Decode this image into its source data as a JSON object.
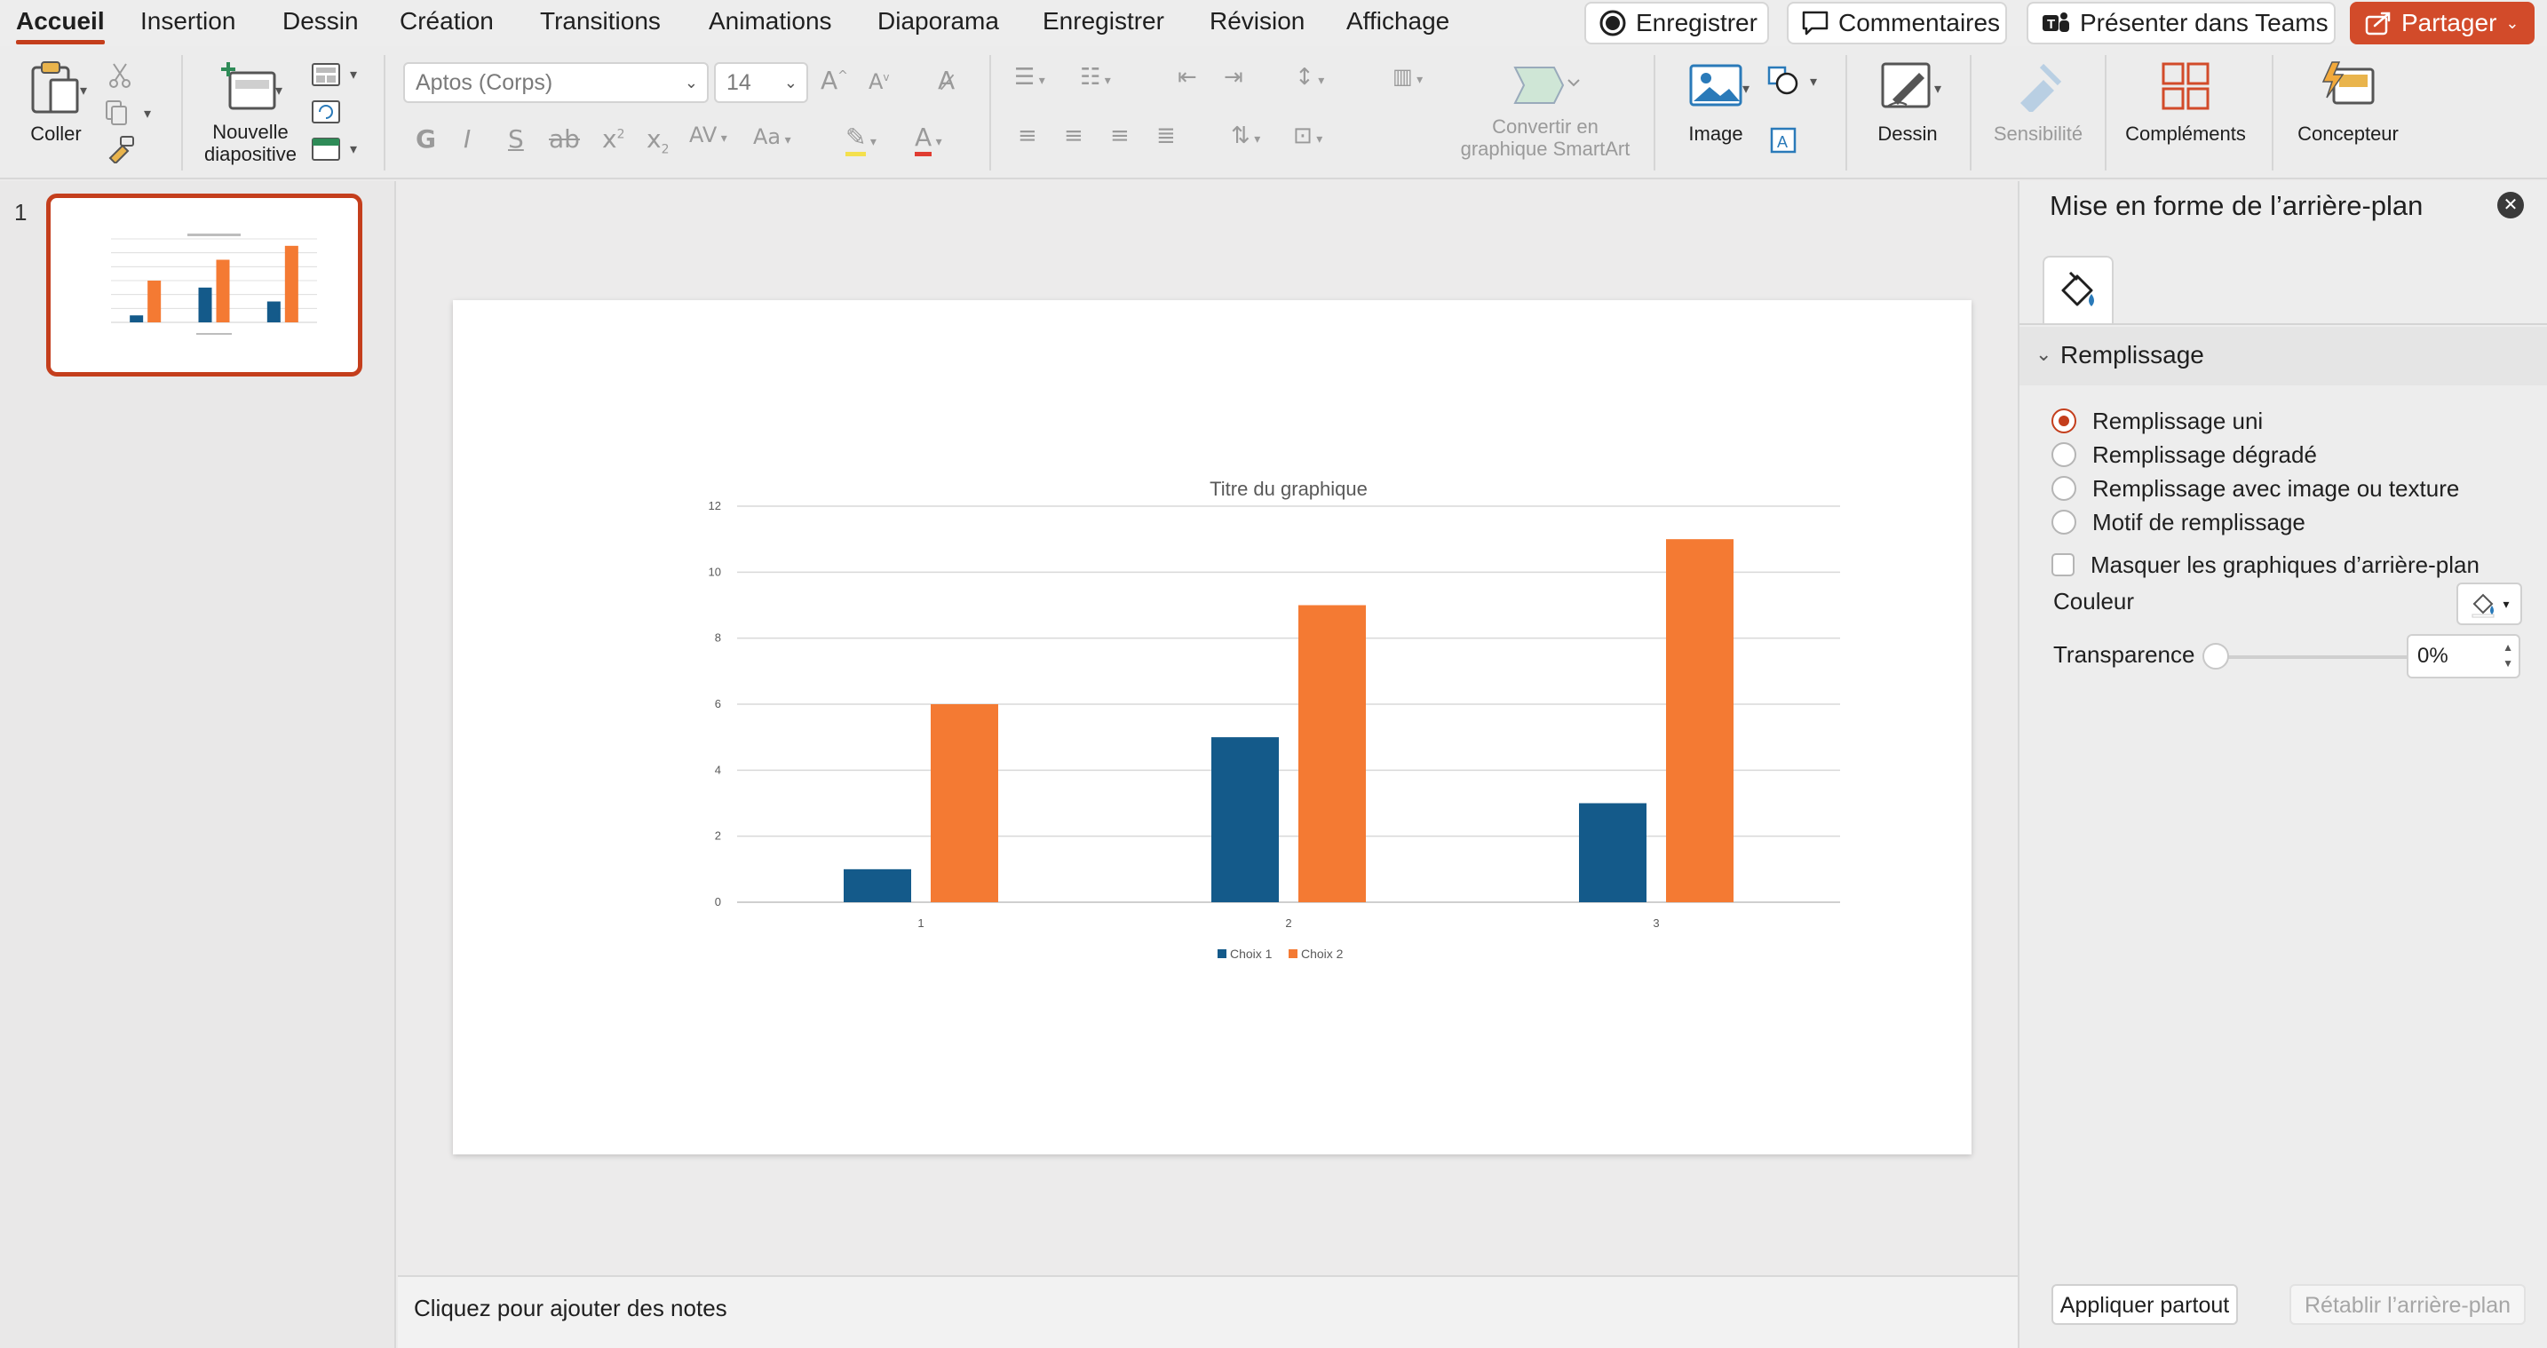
{
  "menu": {
    "tabs": [
      "Accueil",
      "Insertion",
      "Dessin",
      "Création",
      "Transitions",
      "Animations",
      "Diaporama",
      "Enregistrer",
      "Révision",
      "Affichage"
    ],
    "active_tab": "Accueil",
    "record_label": "Enregistrer",
    "comments_label": "Commentaires",
    "teams_label": "Présenter dans Teams",
    "share_label": "Partager"
  },
  "ribbon": {
    "paste_label": "Coller",
    "new_slide_label_1": "Nouvelle",
    "new_slide_label_2": "diapositive",
    "font_name": "Aptos (Corps)",
    "font_size": "14",
    "smartart_label_1": "Convertir en",
    "smartart_label_2": "graphique SmartArt",
    "image_label": "Image",
    "draw_label": "Dessin",
    "sensitivity_label": "Sensibilité",
    "addins_label": "Compléments",
    "designer_label": "Concepteur",
    "bold_glyph": "G",
    "italic_glyph": "I",
    "underline_glyph": "S"
  },
  "thumbnails": {
    "slide_number": "1"
  },
  "chart_data": {
    "type": "bar",
    "title": "Titre du graphique",
    "categories": [
      "1",
      "2",
      "3"
    ],
    "series": [
      {
        "name": "Choix 1",
        "values": [
          1,
          5,
          3
        ],
        "color": "#145a8a"
      },
      {
        "name": "Choix 2",
        "values": [
          6,
          9,
          11
        ],
        "color": "#f47a33"
      }
    ],
    "ylim": [
      0,
      12
    ],
    "yticks": [
      0,
      2,
      4,
      6,
      8,
      10,
      12
    ],
    "grid": true,
    "legend": "bottom"
  },
  "notes": {
    "placeholder": "Cliquez pour ajouter des notes"
  },
  "pane": {
    "title": "Mise en forme de l’arrière-plan",
    "section": "Remplissage",
    "options": [
      "Remplissage uni",
      "Remplissage dégradé",
      "Remplissage avec image ou texture",
      "Motif de remplissage"
    ],
    "selected_option": "Remplissage uni",
    "hide_bg_label": "Masquer les graphiques d’arrière-plan",
    "color_label": "Couleur",
    "transparency_label": "Transparence",
    "transparency_value": "0%",
    "apply_all_label": "Appliquer partout",
    "reset_label": "Rétablir l’arrière-plan"
  },
  "colors": {
    "accent": "#c43e1c",
    "share": "#d24b2a",
    "series1": "#145a8a",
    "series2": "#f47a33"
  }
}
